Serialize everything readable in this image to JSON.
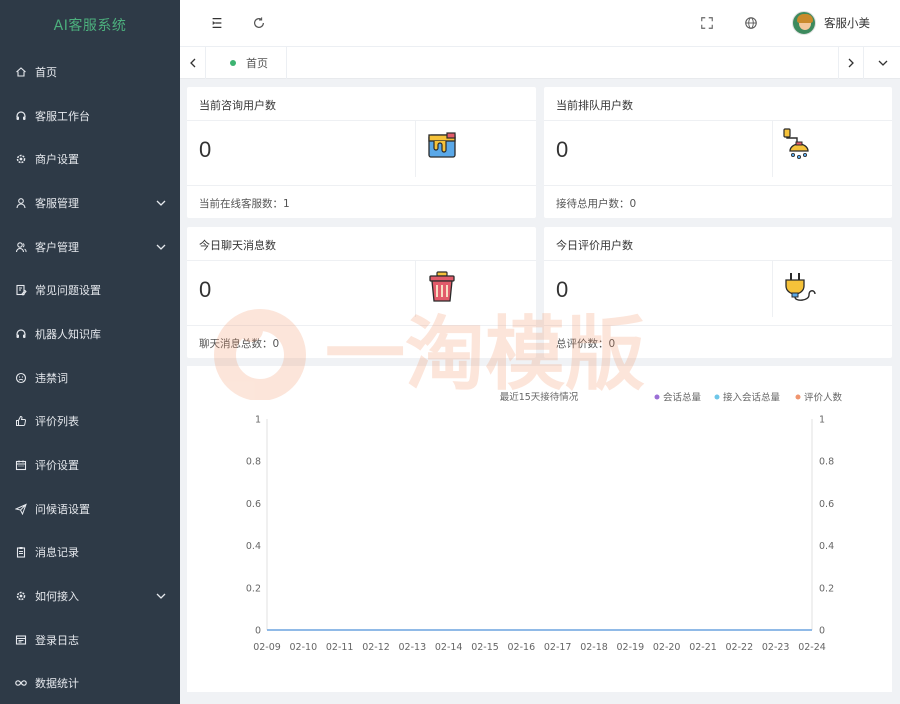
{
  "sidebar": {
    "logo": "AI客服系统",
    "items": [
      {
        "label": "首页",
        "icon": "home-icon",
        "has_children": false
      },
      {
        "label": "客服工作台",
        "icon": "headset-icon",
        "has_children": false
      },
      {
        "label": "商户设置",
        "icon": "gear-icon",
        "has_children": false
      },
      {
        "label": "客服管理",
        "icon": "user-icon",
        "has_children": true
      },
      {
        "label": "客户管理",
        "icon": "user-group-icon",
        "has_children": true
      },
      {
        "label": "常见问题设置",
        "icon": "edit-doc-icon",
        "has_children": false
      },
      {
        "label": "机器人知识库",
        "icon": "robot-icon",
        "has_children": false
      },
      {
        "label": "违禁词",
        "icon": "face-icon",
        "has_children": false
      },
      {
        "label": "评价列表",
        "icon": "thumb-up-icon",
        "has_children": false
      },
      {
        "label": "评价设置",
        "icon": "calendar-icon",
        "has_children": false
      },
      {
        "label": "问候语设置",
        "icon": "send-icon",
        "has_children": false
      },
      {
        "label": "消息记录",
        "icon": "clipboard-icon",
        "has_children": false
      },
      {
        "label": "如何接入",
        "icon": "plugin-icon",
        "has_children": true
      },
      {
        "label": "登录日志",
        "icon": "log-icon",
        "has_children": false
      },
      {
        "label": "数据统计",
        "icon": "infinity-icon",
        "has_children": false
      }
    ]
  },
  "header": {
    "user_name": "客服小美"
  },
  "tabs": {
    "home_label": "首页"
  },
  "cards": [
    {
      "title": "当前咨询用户数",
      "value": "0",
      "footer": "当前在线客服数：1",
      "icon": "paint-bucket-icon"
    },
    {
      "title": "当前排队用户数",
      "value": "0",
      "footer": "接待总用户数：0",
      "icon": "shower-icon"
    },
    {
      "title": "今日聊天消息数",
      "value": "0",
      "footer": "聊天消息总数：0",
      "icon": "trash-bin-icon"
    },
    {
      "title": "今日评价用户数",
      "value": "0",
      "footer": "总评价数：0",
      "icon": "plug-icon"
    }
  ],
  "watermark": "一淘模版",
  "colors": {
    "sidebar_bg": "#2e3a47",
    "logo_green": "#4caf7d",
    "series1": "#9b6fd6",
    "series2": "#6ec6e8",
    "series3": "#f0956f"
  },
  "chart_data": {
    "type": "line",
    "title": "最近15天接待情况",
    "categories": [
      "02-09",
      "02-10",
      "02-11",
      "02-12",
      "02-13",
      "02-14",
      "02-15",
      "02-16",
      "02-17",
      "02-18",
      "02-19",
      "02-20",
      "02-21",
      "02-22",
      "02-23",
      "02-24"
    ],
    "series": [
      {
        "name": "会话总量",
        "values": [
          0,
          0,
          0,
          0,
          0,
          0,
          0,
          0,
          0,
          0,
          0,
          0,
          0,
          0,
          0,
          0
        ]
      },
      {
        "name": "接入会话总量",
        "values": [
          0,
          0,
          0,
          0,
          0,
          0,
          0,
          0,
          0,
          0,
          0,
          0,
          0,
          0,
          0,
          0
        ]
      },
      {
        "name": "评价人数",
        "values": [
          0,
          0,
          0,
          0,
          0,
          0,
          0,
          0,
          0,
          0,
          0,
          0,
          0,
          0,
          0,
          0
        ]
      }
    ],
    "y_ticks": [
      "0",
      "0.2",
      "0.4",
      "0.6",
      "0.8",
      "1"
    ],
    "ylim": [
      0,
      1
    ],
    "legend_position": "top-right",
    "grid": false
  }
}
